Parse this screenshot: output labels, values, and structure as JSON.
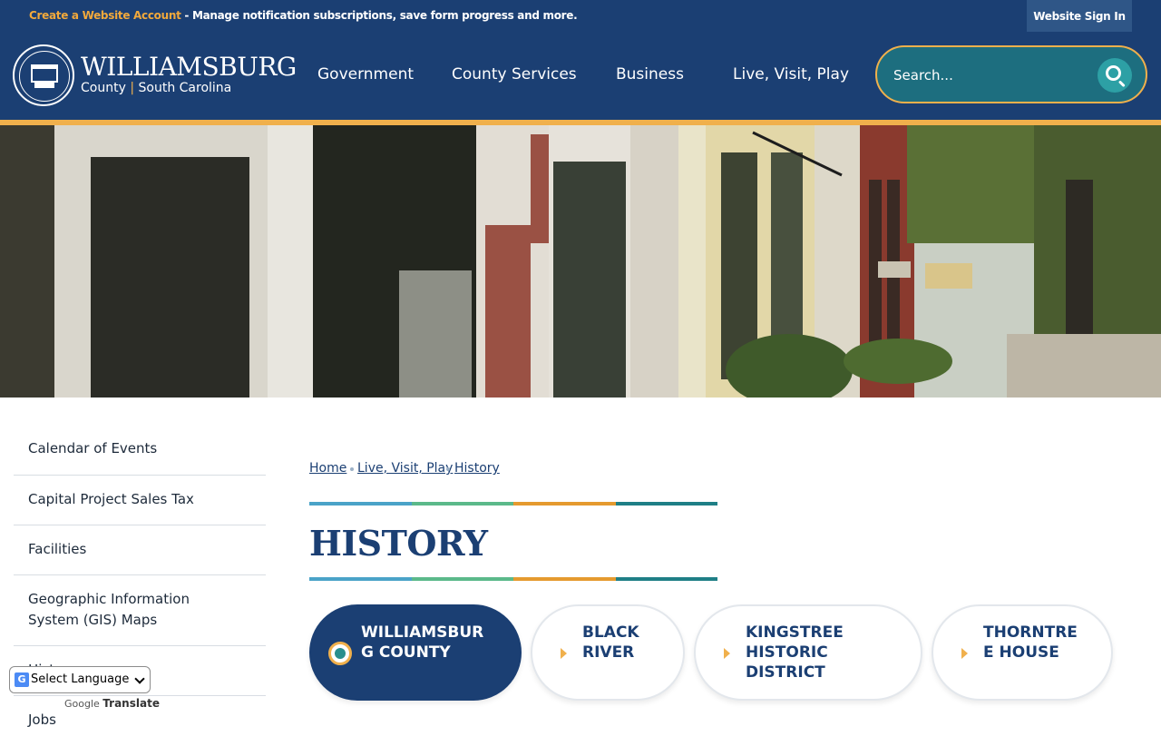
{
  "topbar": {
    "create_account_link": "Create a Website Account",
    "message": " - Manage notification subscriptions, save form progress and more.",
    "signin_label": "Website Sign In"
  },
  "header": {
    "brand_name": "WILLIAMSBURG",
    "brand_county": "County",
    "brand_separator": "|",
    "brand_state": "South Carolina",
    "nav": [
      "Government",
      "County Services",
      "Business",
      "Live, Visit, Play"
    ],
    "search_placeholder": "Search..."
  },
  "sidebar": {
    "items": [
      "Calendar of Events",
      "Capital Project Sales Tax",
      "Facilities",
      "Geographic Information System (GIS) Maps",
      "History",
      "Jobs"
    ]
  },
  "translate": {
    "select_label": "Select Language",
    "powered_by": "Google",
    "translate_label": "Translate"
  },
  "breadcrumb": [
    "Home",
    "Live, Visit, Play",
    "History"
  ],
  "page_title": "HISTORY",
  "tabs": [
    {
      "label": "WILLIAMSBUR G COUNTY",
      "active": true
    },
    {
      "label": "BLACK RIVER",
      "active": false
    },
    {
      "label": "KINGSTREE HISTORIC DISTRICT",
      "active": false
    },
    {
      "label": "THORNTRE E HOUSE",
      "active": false
    }
  ],
  "colors": {
    "navy": "#1b3f73",
    "gold": "#f0b04c",
    "teal": "#1d6e7f",
    "rule_blue": "#4aa3c8",
    "rule_green": "#5bb98a",
    "rule_orange": "#e59a2f",
    "rule_teal": "#1f7f86"
  }
}
